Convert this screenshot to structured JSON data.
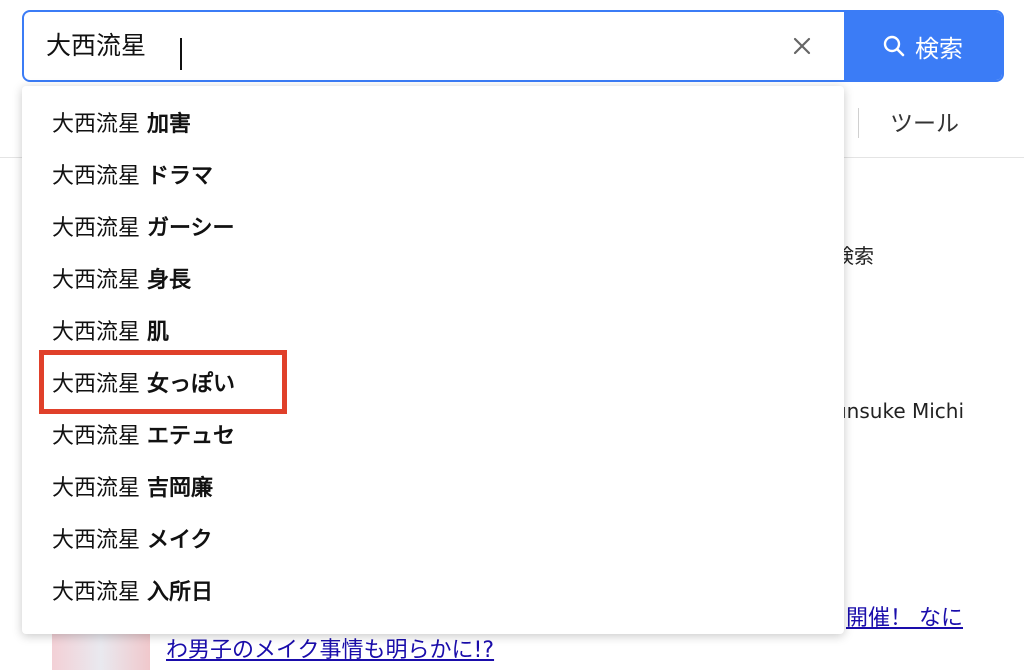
{
  "search": {
    "query": "大西流星",
    "button_label": "検索"
  },
  "background": {
    "tools_label": "ツール",
    "text_partial_1": "検索",
    "text_partial_2": "unsuke Michi",
    "link_partial_1": "開催！ なに",
    "link_partial_2": "わ男子のメイク事情も明らかに!?"
  },
  "suggestions": [
    {
      "query": "大西流星 ",
      "suffix": "加害"
    },
    {
      "query": "大西流星 ",
      "suffix": "ドラマ"
    },
    {
      "query": "大西流星 ",
      "suffix": "ガーシー"
    },
    {
      "query": "大西流星 ",
      "suffix": "身長"
    },
    {
      "query": "大西流星 ",
      "suffix": "肌"
    },
    {
      "query": "大西流星 ",
      "suffix": "女っぽい"
    },
    {
      "query": "大西流星 ",
      "suffix": "エテュセ"
    },
    {
      "query": "大西流星 ",
      "suffix": "吉岡廉"
    },
    {
      "query": "大西流星 ",
      "suffix": "メイク"
    },
    {
      "query": "大西流星 ",
      "suffix": "入所日"
    }
  ],
  "colors": {
    "accent": "#3b7cf6",
    "highlight": "#e0402a",
    "link": "#1a0dab"
  },
  "icons": {
    "clear": "close-icon",
    "search": "search-icon"
  }
}
